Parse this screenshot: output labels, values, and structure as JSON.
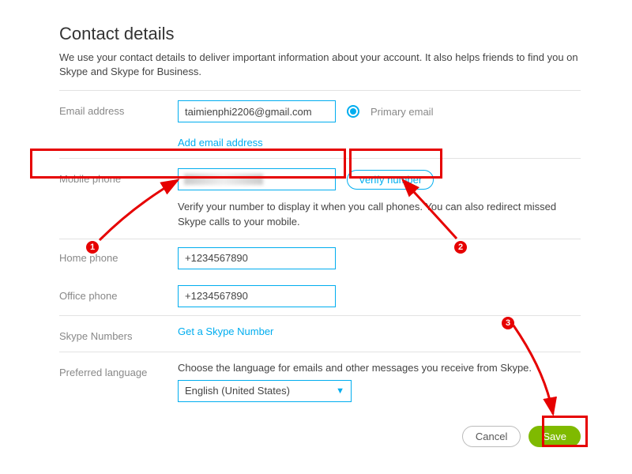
{
  "header": {
    "title": "Contact details",
    "intro": "We use your contact details to deliver important information about your account. It also helps friends to find you on Skype and Skype for Business."
  },
  "email": {
    "label": "Email address",
    "value": "taimienphi2206@gmail.com",
    "primary_label": "Primary email",
    "add_link": "Add email address"
  },
  "mobile": {
    "label": "Mobile phone",
    "value": "",
    "verify_label": "Verify number",
    "note": "Verify your number to display it when you call phones. You can also redirect missed Skype calls to your mobile."
  },
  "home": {
    "label": "Home phone",
    "value": "+1234567890"
  },
  "office": {
    "label": "Office phone",
    "value": "+1234567890"
  },
  "skype_numbers": {
    "label": "Skype Numbers",
    "link": "Get a Skype Number"
  },
  "language": {
    "label": "Preferred language",
    "desc": "Choose the language for emails and other messages you receive from Skype.",
    "value": "English (United States)"
  },
  "buttons": {
    "cancel": "Cancel",
    "save": "Save"
  },
  "annotations": {
    "n1": "1",
    "n2": "2",
    "n3": "3"
  }
}
